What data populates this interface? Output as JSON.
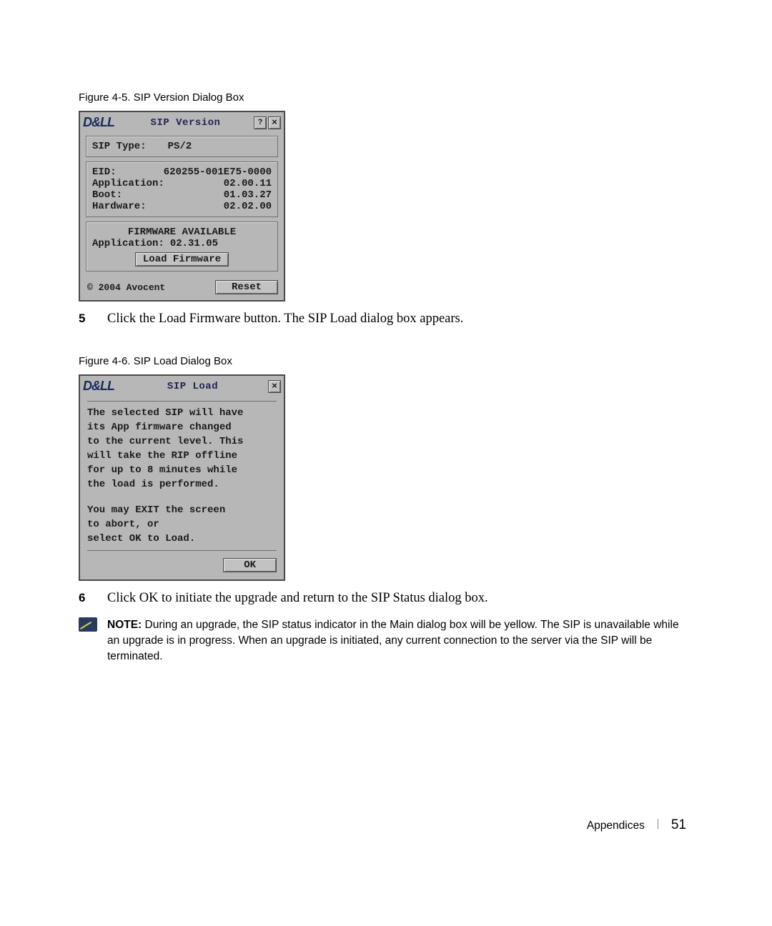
{
  "figure1_caption": "Figure 4-5.    SIP Version Dialog Box",
  "figure2_caption": "Figure 4-6.    SIP Load Dialog Box",
  "dell_brand": "D&LL",
  "dialog1": {
    "title": "SIP Version",
    "help_btn": "?",
    "close_btn": "×",
    "type_row_label": "SIP Type:",
    "type_value": "PS/2",
    "eid_row_label": "EID:",
    "eid_value": "620255-001E75-0000",
    "app_label": "Application:",
    "app_value": "02.00.11",
    "boot_label": "Boot:",
    "boot_value": "01.03.27",
    "hw_label": "Hardware:",
    "hw_value": "02.02.00",
    "fw_avail_title": "FIRMWARE AVAILABLE",
    "fw_app_label": "Application:",
    "fw_app_value": "02.31.05",
    "load_fw_btn": "Load Firmware",
    "copyright": "© 2004 Avocent",
    "reset_btn": "Reset"
  },
  "dialog2": {
    "title": "SIP Load",
    "close_btn": "×",
    "msg_l1": "The selected SIP will have",
    "msg_l2": "its App firmware changed",
    "msg_l3": "to the current level.  This",
    "msg_l4": "will take the RIP offline",
    "msg_l5": "for up to 8 minutes while",
    "msg_l6": "the load is performed.",
    "msg_l7": "You may EXIT the screen",
    "msg_l8": "to abort, or",
    "msg_l9": "select OK to Load.",
    "ok_btn": "OK"
  },
  "step5_num": "5",
  "step5_text": "Click the Load Firmware button. The SIP Load dialog box appears.",
  "step6_num": "6",
  "step6_text": "Click OK to initiate the upgrade and return to the SIP Status dialog box.",
  "note_label": "NOTE:",
  "note_text": "During an upgrade, the SIP status indicator in the Main dialog box will be yellow. The SIP is unavailable while an upgrade is in progress. When an upgrade is initiated, any current connection to the server via the SIP will be terminated.",
  "footer_section": "Appendices",
  "page_number": "51"
}
